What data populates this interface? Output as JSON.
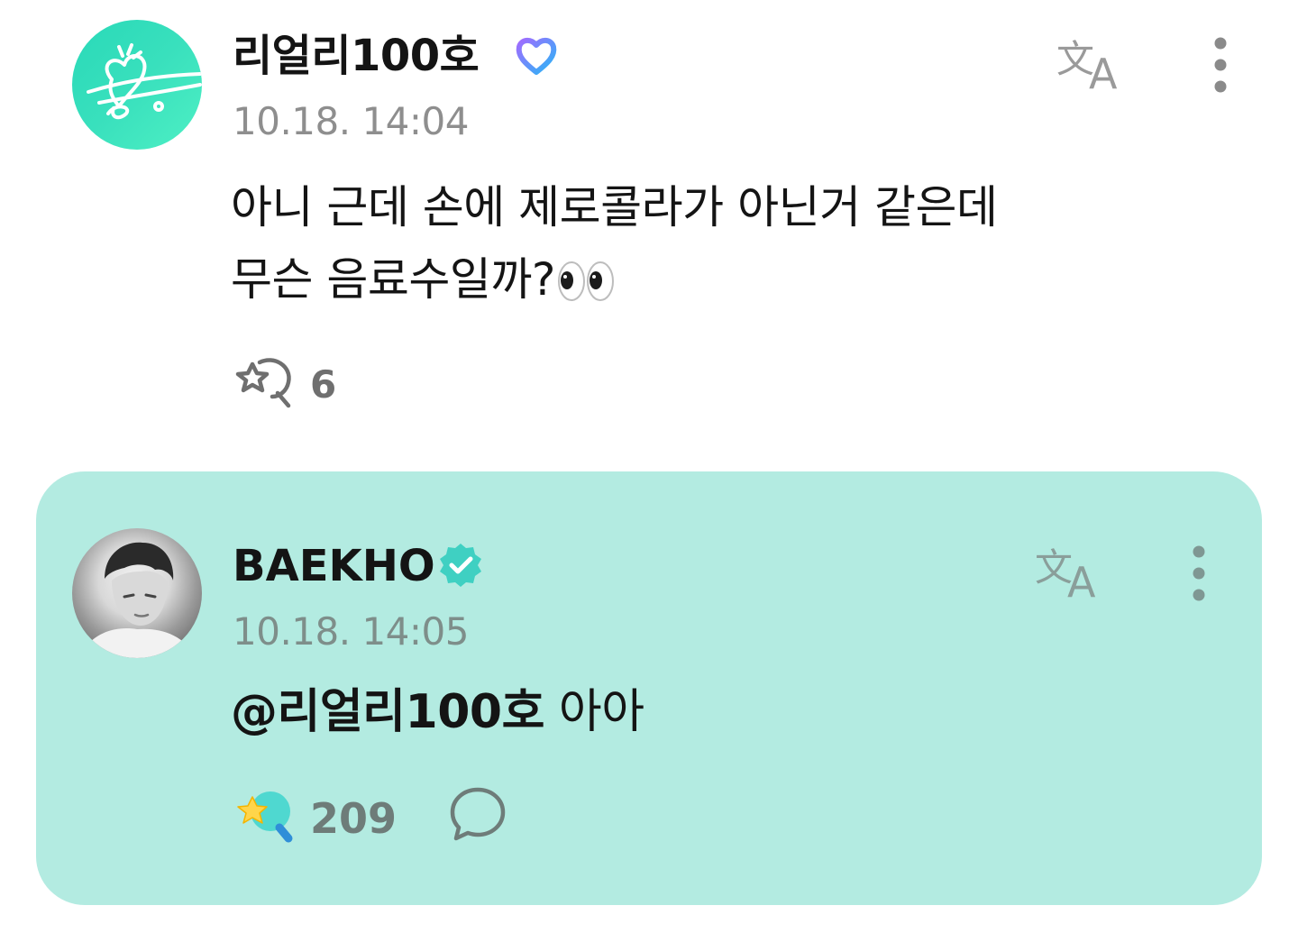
{
  "comments": [
    {
      "author": "리얼리100호",
      "timestamp": "10.18. 14:04",
      "text": "아니 근데 손에 제로콜라가 아닌거 같은데\n무슨 음료수일까?",
      "emoji": "eyes",
      "like_count": "6",
      "badge_icon": "heart-badge-icon",
      "avatar_color": "#35dcbc"
    },
    {
      "author": "BAEKHO",
      "timestamp": "10.18. 14:05",
      "mention": "@리얼리100호",
      "text": " 아아",
      "like_count": "209",
      "badge_icon": "verified-check-icon",
      "highlight_color": "#b3ebe1"
    }
  ]
}
